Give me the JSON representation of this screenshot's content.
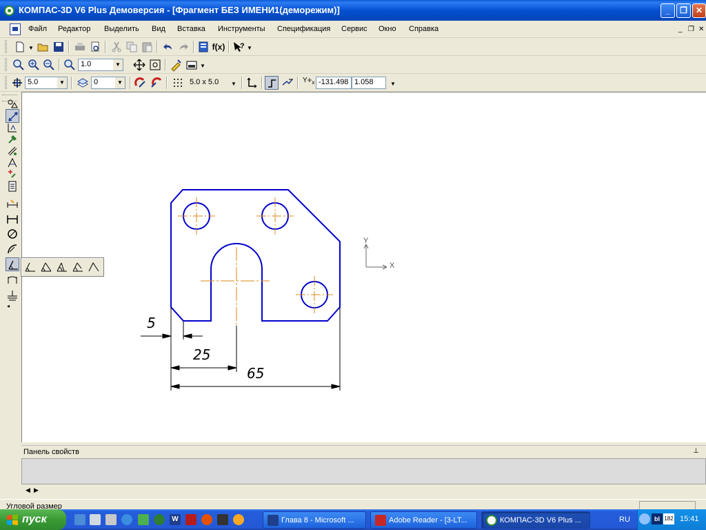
{
  "window": {
    "title": "КОМПАС-3D V6 Plus Демоверсия - [Фрагмент БЕЗ ИМЕНИ1(деморежим)]",
    "controls": [
      "minimize",
      "restore",
      "close"
    ]
  },
  "menu": {
    "items": [
      {
        "label": "Файл"
      },
      {
        "label": "Редактор"
      },
      {
        "label": "Выделить"
      },
      {
        "label": "Вид"
      },
      {
        "label": "Вставка"
      },
      {
        "label": "Инструменты"
      },
      {
        "label": "Спецификация"
      },
      {
        "label": "Сервис"
      },
      {
        "label": "Окно"
      },
      {
        "label": "Справка"
      }
    ],
    "mdi_controls": [
      "minimize",
      "restore",
      "close"
    ]
  },
  "toolbar_standard": {
    "icons": [
      "new-document-icon",
      "open-icon",
      "save-icon",
      "print-icon",
      "print-preview-icon",
      "cut-icon",
      "copy-icon",
      "paste-icon",
      "undo-icon",
      "redo-icon",
      "manager-icon",
      "variables-icon",
      "help-icon"
    ],
    "fx_label": "f(x)"
  },
  "toolbar_view": {
    "zoom_value": "1.0",
    "icons": [
      "zoom-window-icon",
      "zoom-in-icon",
      "zoom-out-icon",
      "zoom-scale-icon",
      "pan-icon",
      "zoom-all-icon",
      "redraw-icon",
      "layer-view-icon"
    ]
  },
  "toolbar_current_state": {
    "step_value": "5.0",
    "layer_value": "0",
    "grid_value": "5.0 x 5.0",
    "coord_x": "-131.498",
    "coord_y": "1.058",
    "coords_label": "Yx"
  },
  "drawing": {
    "dimensions": [
      "5",
      "25",
      "65"
    ],
    "axis_labels": {
      "y": "Y",
      "x": "X"
    },
    "colors": {
      "contour": "#0000cc",
      "centerline": "#d98a1a",
      "dimension": "#000000"
    }
  },
  "left_toolbar": {
    "icons": [
      "geometry-icon",
      "edit-icon",
      "dimensions-icon",
      "symbols-icon",
      "measure-icon",
      "select-icon",
      "parametrize-icon",
      "spec-icon",
      "linear-dim-icon",
      "diameter-dim-icon",
      "radial-dim-icon",
      "angular-dim-icon",
      "arc-dim-icon",
      "leader-icon"
    ]
  },
  "flyout": {
    "icons": [
      "angle-dim-icon",
      "angle-dim-ext-icon",
      "angle-dim-base-icon",
      "angle-dim-chain-icon",
      "angle-dim-free-icon"
    ]
  },
  "properties_panel": {
    "title": "Панель свойств"
  },
  "status": {
    "text": "Угловой размер"
  },
  "taskbar": {
    "start_label": "пуск",
    "tasks": [
      {
        "label": "Глава 8 - Microsoft ..."
      },
      {
        "label": "Adobe Reader - [3-LT..."
      },
      {
        "label": "КОМПАС-3D V6 Plus ..."
      }
    ],
    "language": "RU",
    "clock": "15:41",
    "tray_badge": "182"
  }
}
